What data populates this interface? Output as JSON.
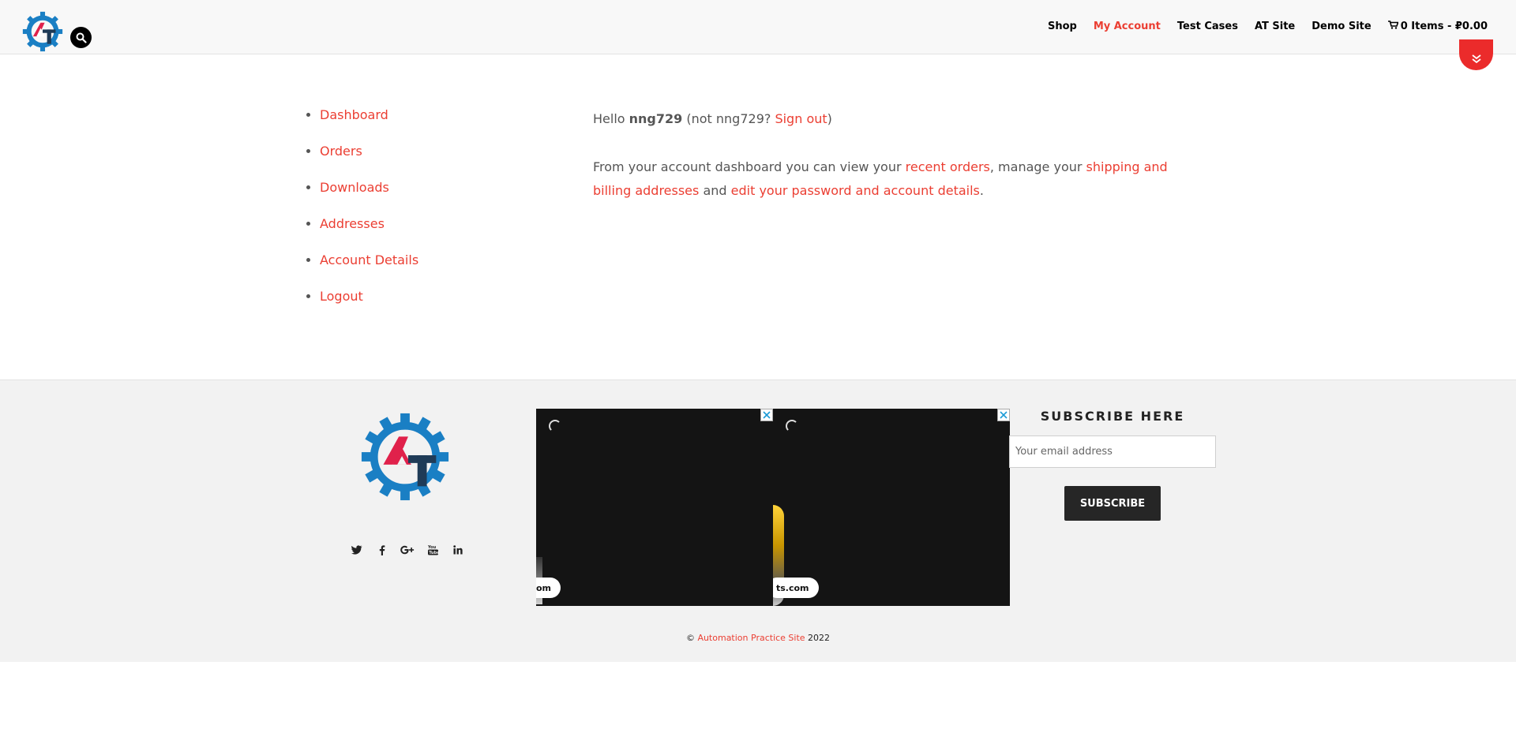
{
  "header": {
    "logo_icon": "at-gear-logo",
    "search_icon": "search-icon",
    "nav": [
      {
        "label": "Shop",
        "active": false
      },
      {
        "label": "My Account",
        "active": true
      },
      {
        "label": "Test Cases",
        "active": false
      },
      {
        "label": "AT Site",
        "active": false
      },
      {
        "label": "Demo Site",
        "active": false
      }
    ],
    "cart_label": "0 Items - ₽0.00",
    "scroll_icon": "double-chevron-down-icon"
  },
  "account_nav": [
    "Dashboard",
    "Orders",
    "Downloads",
    "Addresses",
    "Account Details",
    "Logout"
  ],
  "content": {
    "hello_prefix": "Hello ",
    "username": "nng729",
    "not_prefix": " (not nng729? ",
    "sign_out": "Sign out",
    "not_suffix": ")",
    "intro": "From your account dashboard you can view your ",
    "recent_orders": "recent orders",
    "manage": ", manage your ",
    "shipping": "shipping and billing addresses",
    "and": " and ",
    "edit_account": "edit your password and account details",
    "period": "."
  },
  "footer": {
    "social": [
      "twitter-icon",
      "facebook-icon",
      "google-plus-icon",
      "youtube-icon",
      "linkedin-icon"
    ],
    "ads": [
      {
        "pill": "om"
      },
      {
        "pill": "ts.com"
      }
    ],
    "subscribe_title": "SUBSCRIBE HERE",
    "email_placeholder": "Your email address",
    "subscribe_button": "SUBSCRIBE",
    "copyright_symbol": "© ",
    "site_link": "Automation Practice Site",
    "year": " 2022"
  },
  "colors": {
    "accent": "#eb3e32",
    "logo_blue": "#1a7fc4",
    "logo_red": "#e0214b",
    "logo_dark": "#1f3b57"
  }
}
